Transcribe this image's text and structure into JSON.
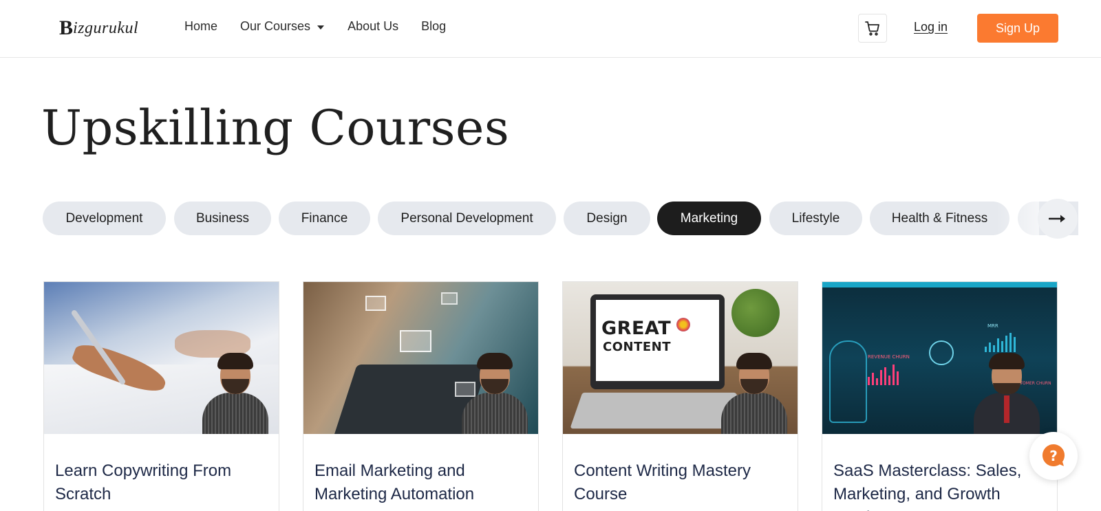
{
  "brand": {
    "logo_letter": "B",
    "logo_rest": "izgurukul"
  },
  "nav": {
    "home": "Home",
    "courses": "Our Courses",
    "about": "About Us",
    "blog": "Blog"
  },
  "header": {
    "login": "Log in",
    "signup": "Sign Up"
  },
  "page": {
    "title": "Upskilling Courses"
  },
  "categories": [
    {
      "label": "Development",
      "active": false
    },
    {
      "label": "Business",
      "active": false
    },
    {
      "label": "Finance",
      "active": false
    },
    {
      "label": "Personal Development",
      "active": false
    },
    {
      "label": "Design",
      "active": false
    },
    {
      "label": "Marketing",
      "active": true
    },
    {
      "label": "Lifestyle",
      "active": false
    },
    {
      "label": "Health & Fitness",
      "active": false
    }
  ],
  "courses": [
    {
      "title": "Learn Copywriting From Scratch"
    },
    {
      "title": "Email Marketing and Marketing Automation"
    },
    {
      "title": "Content Writing Mastery Course",
      "thumb_text_1": "GREAT",
      "thumb_text_2": "CONTENT"
    },
    {
      "title": "SaaS Masterclass: Sales, Marketing, and Growth Metrics",
      "thumb_label_1": "REVENUE CHURN",
      "thumb_label_2": "MRR",
      "thumb_label_3": "CUSTOMER CHURN"
    }
  ],
  "colors": {
    "accent": "#fb7a30",
    "active_pill": "#1d1d1d",
    "pill": "#e6e9ee",
    "help_icon": "#f07b2e"
  },
  "icons": {
    "cart": "cart-icon",
    "arrow": "arrow-right-icon",
    "help": "question-icon"
  }
}
